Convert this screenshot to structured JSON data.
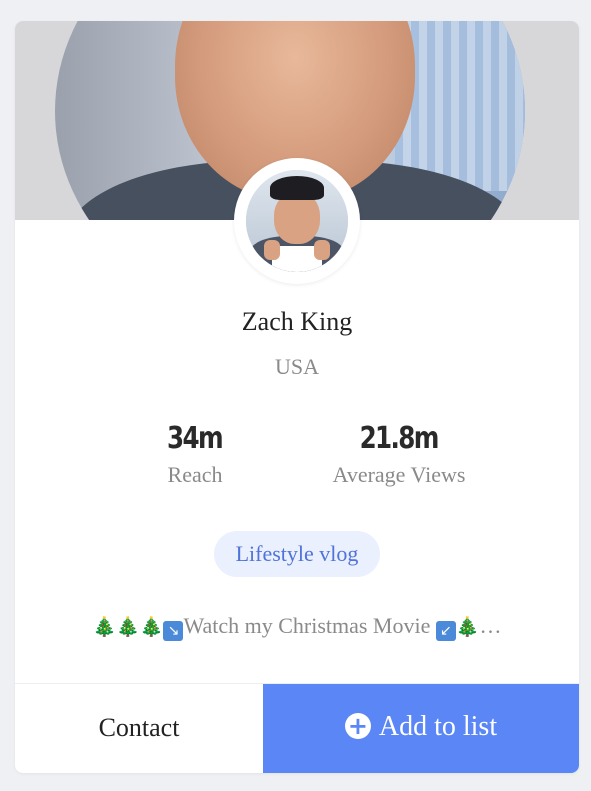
{
  "profile": {
    "name": "Zach King",
    "country": "USA"
  },
  "stats": [
    {
      "value": "34m",
      "label": "Reach"
    },
    {
      "value": "21.8m",
      "label": "Average Views"
    }
  ],
  "tag": "Lifestyle vlog",
  "bio": {
    "text": "Watch my Christmas Movie",
    "ellipsis": "…",
    "icons": [
      "christmas-tree-icon",
      "christmas-tree-icon",
      "christmas-tree-icon",
      "arrow-down-right-icon",
      "arrow-down-left-icon",
      "christmas-tree-icon"
    ]
  },
  "actions": {
    "contact_label": "Contact",
    "add_label": "Add to list"
  },
  "colors": {
    "accent": "#5a86f6",
    "tag_bg": "#eaf0fd",
    "tag_text": "#4f73d9",
    "muted_text": "#8a8a8a"
  }
}
